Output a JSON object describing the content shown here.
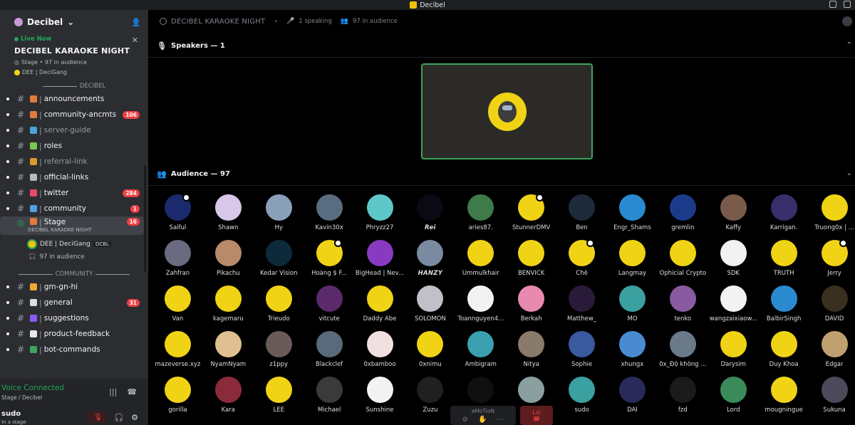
{
  "titlebar": {
    "app_name": "Decibel"
  },
  "sidebar": {
    "guild_name": "Decibel",
    "live": {
      "label": "Live Now",
      "title": "DECIBEL KARAOKE NIGHT",
      "meta": "Stage • 97 in audience",
      "host": "DEE | DeciGang"
    },
    "categories": {
      "decibel": "DECIBEL",
      "community": "COMMUNITY"
    },
    "channels_decibel": [
      {
        "name": "announcements",
        "emoji_color": "#e07b39",
        "badge": "",
        "muted": false
      },
      {
        "name": "community-ancmts",
        "emoji_color": "#e07b39",
        "badge": "106",
        "muted": false
      },
      {
        "name": "server-guide",
        "emoji_color": "#4aa3df",
        "badge": "",
        "muted": true
      },
      {
        "name": "roles",
        "emoji_color": "#7ac74f",
        "badge": "",
        "muted": false
      },
      {
        "name": "referral-link",
        "emoji_color": "#d99a2b",
        "badge": "",
        "muted": true
      },
      {
        "name": "official-links",
        "emoji_color": "#b5bac1",
        "badge": "",
        "muted": false
      },
      {
        "name": "twitter",
        "emoji_color": "#e8476a",
        "badge": "284",
        "muted": false
      },
      {
        "name": "community",
        "emoji_color": "#4aa3df",
        "badge": "1",
        "muted": false
      }
    ],
    "stage_channel": {
      "name": "Stage",
      "subtitle": "DECIBEL KARAOKE NIGHT",
      "badge": "16",
      "speaker_name": "DEE | DeciGang",
      "speaker_tag": "DCBL",
      "audience": "97 in audience"
    },
    "channels_community": [
      {
        "name": "gm-gn-hi",
        "emoji_color": "#f0a830",
        "badge": "",
        "muted": false
      },
      {
        "name": "general",
        "emoji_color": "#dbdee1",
        "badge": "31",
        "muted": false
      },
      {
        "name": "suggestions",
        "emoji_color": "#8a5cf5",
        "badge": "",
        "muted": false
      },
      {
        "name": "product-feedback",
        "emoji_color": "#e8e8e8",
        "badge": "",
        "muted": false
      },
      {
        "name": "bot-commands",
        "emoji_color": "#3ba55d",
        "badge": "",
        "muted": false
      }
    ],
    "voice": {
      "status": "Voice Connected",
      "location": "Stage / Decibel"
    },
    "user": {
      "name": "sudo",
      "status": "In a stage"
    }
  },
  "main": {
    "topbar": {
      "title": "DECIBEL KARAOKE NIGHT",
      "speaking": "1 speaking",
      "audience": "97 in audience"
    },
    "speakers_header": "Speakers — 1",
    "audience_header": "Audience — 97",
    "audience": [
      {
        "name": "Saiful",
        "color": "#1a2a6c"
      },
      {
        "name": "Shawn",
        "color": "#d8c7e8"
      },
      {
        "name": "Hy",
        "color": "#8aa0b8"
      },
      {
        "name": "Kavin30x",
        "color": "#5a6d80"
      },
      {
        "name": "Phryzz27",
        "color": "#5ec8c8"
      },
      {
        "name": "Rei",
        "color": "#0a0a14"
      },
      {
        "name": "aries87.",
        "color": "#3f7a4a"
      },
      {
        "name": "StunnerDMV",
        "color": "#f0d315"
      },
      {
        "name": "Ben",
        "color": "#1d2a3a"
      },
      {
        "name": "Engr_Shams",
        "color": "#2a8ad0"
      },
      {
        "name": "gremlin",
        "color": "#1b3a8a"
      },
      {
        "name": "Kaffy",
        "color": "#7a5a4a"
      },
      {
        "name": "Karrigan.",
        "color": "#3a2e6a"
      },
      {
        "name": "Truong0x | ...",
        "color": "#f0d315"
      },
      {
        "name": "Zahfran",
        "color": "#6a6a80"
      },
      {
        "name": "Pikachu",
        "color": "#b88a6a"
      },
      {
        "name": "Kedar Vision",
        "color": "#0d2a3a"
      },
      {
        "name": "Hoàng $ F...",
        "color": "#f0d315"
      },
      {
        "name": "BigHead | Nev...",
        "color": "#8a3ac0"
      },
      {
        "name": "HANZY",
        "color": "#7a8aa0"
      },
      {
        "name": "Ummulkhair",
        "color": "#f0d315"
      },
      {
        "name": "BENVICK",
        "color": "#f0d315"
      },
      {
        "name": "Chê",
        "color": "#f0d315"
      },
      {
        "name": "Langmay",
        "color": "#f0d315"
      },
      {
        "name": "Ophicial Crypto",
        "color": "#f0d315"
      },
      {
        "name": "SDK",
        "color": "#f2f2f2"
      },
      {
        "name": "TRUTH",
        "color": "#f0d315"
      },
      {
        "name": "Jerry",
        "color": "#f0d315"
      },
      {
        "name": "Van",
        "color": "#f0d315"
      },
      {
        "name": "kagemaru",
        "color": "#f0d315"
      },
      {
        "name": "Trieudo",
        "color": "#f0d315"
      },
      {
        "name": "vitcute",
        "color": "#5a2a6a"
      },
      {
        "name": "Daddy Abe",
        "color": "#f0d315"
      },
      {
        "name": "SOLOMON",
        "color": "#c0c0c8"
      },
      {
        "name": "Toannguyen4...",
        "color": "#f2f2f2"
      },
      {
        "name": "Berkah",
        "color": "#e88ab0"
      },
      {
        "name": "Matthew_",
        "color": "#2a1a3a"
      },
      {
        "name": "MO",
        "color": "#3aa0a0"
      },
      {
        "name": "tenko",
        "color": "#8a5aa0"
      },
      {
        "name": "wangzaixiaow...",
        "color": "#f2f2f2"
      },
      {
        "name": "BalbirSingh",
        "color": "#2a8ad0"
      },
      {
        "name": "DAVID",
        "color": "#3a3020"
      },
      {
        "name": "mazeverse.xyz",
        "color": "#f0d315"
      },
      {
        "name": "NyamNyam",
        "color": "#e0c090"
      },
      {
        "name": "z1ppy",
        "color": "#6a5a5a"
      },
      {
        "name": "Blackclef",
        "color": "#5a6a7a"
      },
      {
        "name": "0xbamboo",
        "color": "#f2e0e0"
      },
      {
        "name": "0xnimu",
        "color": "#f0d315"
      },
      {
        "name": "Ambigram",
        "color": "#3aa0b0"
      },
      {
        "name": "Nitya",
        "color": "#8a7a6a"
      },
      {
        "name": "Sophie",
        "color": "#3a5aa0"
      },
      {
        "name": "xhungx",
        "color": "#4a8ad0"
      },
      {
        "name": "0x_Độ không ...",
        "color": "#6a7a8a"
      },
      {
        "name": "Darysim",
        "color": "#f0d315"
      },
      {
        "name": "Duy Khoa",
        "color": "#f0d315"
      },
      {
        "name": "Edgar",
        "color": "#c0a070"
      },
      {
        "name": "gorilla",
        "color": "#f0d315"
      },
      {
        "name": "Kara",
        "color": "#8a2a3a"
      },
      {
        "name": "LEE",
        "color": "#f0d315"
      },
      {
        "name": "Michael",
        "color": "#3a3a3a"
      },
      {
        "name": "Sunshine",
        "color": "#f2f2f2"
      },
      {
        "name": "Zuzu",
        "color": "#202020"
      },
      {
        "name": "eMoTioN",
        "color": "#101010"
      },
      {
        "name": "Loi",
        "color": "#8aa0a0"
      },
      {
        "name": "sudo",
        "color": "#3aa0a0"
      },
      {
        "name": "DAI",
        "color": "#2a2a5a"
      },
      {
        "name": "fzd",
        "color": "#1a1a1a"
      },
      {
        "name": "Lord",
        "color": "#3a8a5a"
      },
      {
        "name": "mougningue",
        "color": "#f0d315"
      },
      {
        "name": "Sukuna",
        "color": "#4a4a5a"
      }
    ],
    "controls": {
      "emotion_label": "eMoTioN",
      "leave_label": "Loi"
    }
  },
  "colors": {
    "accent_green": "#23a55a",
    "badge_red": "#f23f43",
    "brand_yellow": "#f0d315"
  }
}
